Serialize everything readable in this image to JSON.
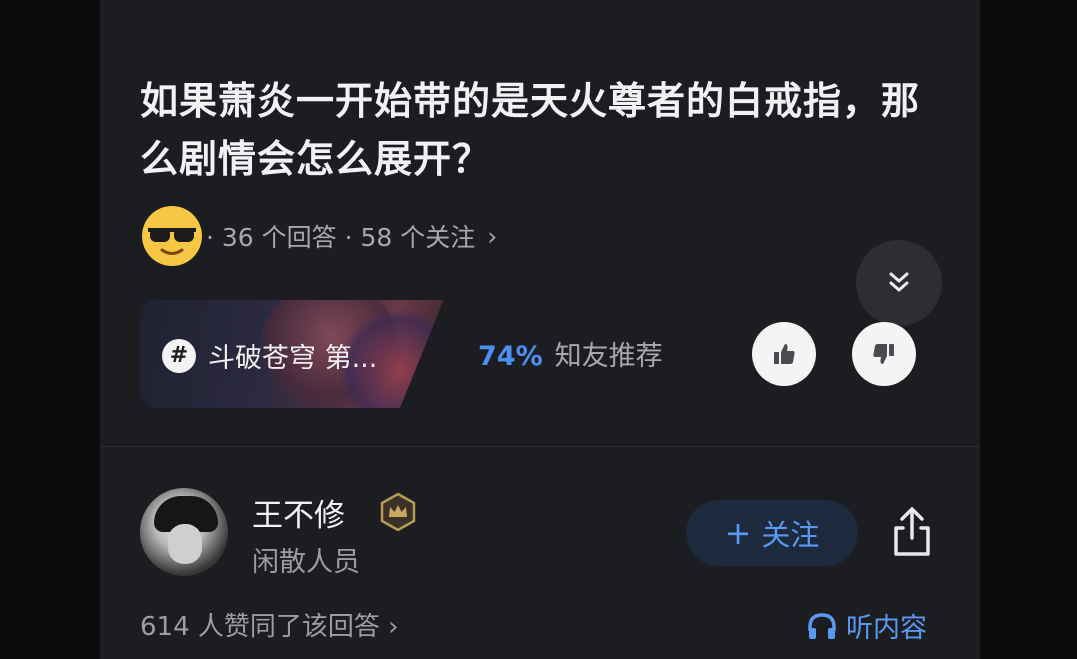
{
  "question": {
    "title": "如果萧炎一开始带的是天火尊者的白戒指，那么剧情会怎么展开？",
    "stats": "· 36 个回答 · 58 个关注",
    "stats_chevron": "›"
  },
  "topic": {
    "label": "斗破苍穹 第...",
    "icon": "hashtag-icon"
  },
  "recommend": {
    "percent": "74%",
    "label": "知友推荐"
  },
  "author": {
    "name": "王不修",
    "description": "闲散人员",
    "badge": "crown-badge-icon"
  },
  "actions": {
    "follow_plus": "+",
    "follow_label": "关注"
  },
  "footer": {
    "likes_text": "614 人赞同了该回答 ›",
    "listen_label": "听内容"
  },
  "colors": {
    "accent_blue": "#4d8ff0",
    "background": "#1c1d21",
    "follow_bg": "#1d2a3e"
  }
}
